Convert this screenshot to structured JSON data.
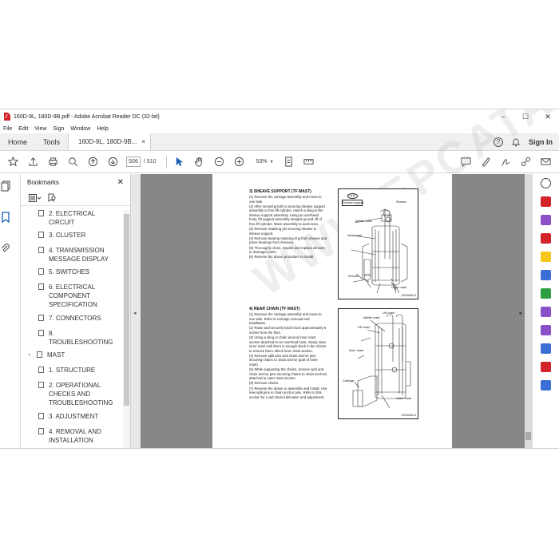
{
  "window": {
    "title": "160D-9L, 180D-9B.pdf - Adobe Acrobat Reader DC (32-bit)",
    "controls": [
      "–",
      "☐",
      "✕"
    ]
  },
  "menu": [
    "File",
    "Edit",
    "View",
    "Sign",
    "Window",
    "Help"
  ],
  "tabs": {
    "home": "Home",
    "tools": "Tools",
    "document": "160D-9L, 180D-9B...",
    "close": "×",
    "signin": "Sign In"
  },
  "toolbar": {
    "page_current": "506",
    "page_total": "/ 510",
    "zoom": "53%"
  },
  "bookmarks": {
    "title": "Bookmarks",
    "close": "✕",
    "items": [
      {
        "label": "2. ELECTRICAL CIRCUIT"
      },
      {
        "label": "3. CLUSTER"
      },
      {
        "label": "4. TRANSMISSION MESSAGE DISPLAY"
      },
      {
        "label": "5. SWITCHES"
      },
      {
        "label": "6. ELECTRICAL COMPONENT SPECIFICATION"
      },
      {
        "label": "7. CONNECTORS"
      },
      {
        "label": "8. TROUBLESHOOTING"
      },
      {
        "label": "MAST"
      },
      {
        "label": "1. STRUCTURE"
      },
      {
        "label": "2. OPERATIONAL CHECKS AND TROUBLESHOOTING"
      },
      {
        "label": "3. ADJUSTMENT"
      },
      {
        "label": "4. REMOVAL AND INSTALLATION"
      }
    ]
  },
  "document": {
    "section3": {
      "title": "3) SHEAVE SUPPORT (TF MAST)",
      "steps": [
        "(1) Remove the carriage assembly and move to one side.",
        "(2) After removing bolt to securing sheave support assembly to free lift cylinder. Attach a sling to the sheave support assembly. Using an overhead hoist, lift support assembly straight up and off of free lift cylinder. Move assembly to work area.",
        "(3) Remove retaining pin securing sheave to sheave support.",
        "(4) Remove bearing retaining ring from sheave and press bearings from sheaves.",
        "(5) Thoroughly clean, inspect and replace all worn or damaged parts.",
        "(6) Reverse the above procedure to install."
      ],
      "figure": {
        "badge": "A,B",
        "labels": [
          "Sheave support",
          "Sheave",
          "Middle mast",
          "Inner mast",
          "Sheave",
          "Outer mast"
        ],
        "code": "D505A8813"
      }
    },
    "section4": {
      "title": "4) REAR CHAIN (TF MAST)",
      "steps": [
        "(1) Remove the carriage assembly and move to one side. Refer to carriage removal and installation.",
        "(2) Raise and securely block truck approximately 6 inches from the floor.",
        "(3) Using a sling or chain around inner mast section attached to an overhead hoist, slowly raise inner mast until there is enough slack in the chains to remove them. Block inner mast section.",
        "(4) Remove split pins and chain anchor pins securing chains to chain anchor (part of inner mast).",
        "(5) While supporting the chains, remove split and chain anchor pins securing chains to chain anchors attached to outer mast section.",
        "(6) Remove chains.",
        "(7) Reverse the above to assemble and install. Use new split pins in chain anchor pins. Refer to this section for Load chain lubrication and adjustment."
      ],
      "figure": {
        "labels": [
          "Lift chain",
          "Middle mast",
          "Lift chain",
          "Inner mast",
          "Carriage",
          "Outer mast"
        ],
        "code": "D505A8814"
      }
    },
    "watermark": "WWW.EPCATALOGS.COM"
  }
}
